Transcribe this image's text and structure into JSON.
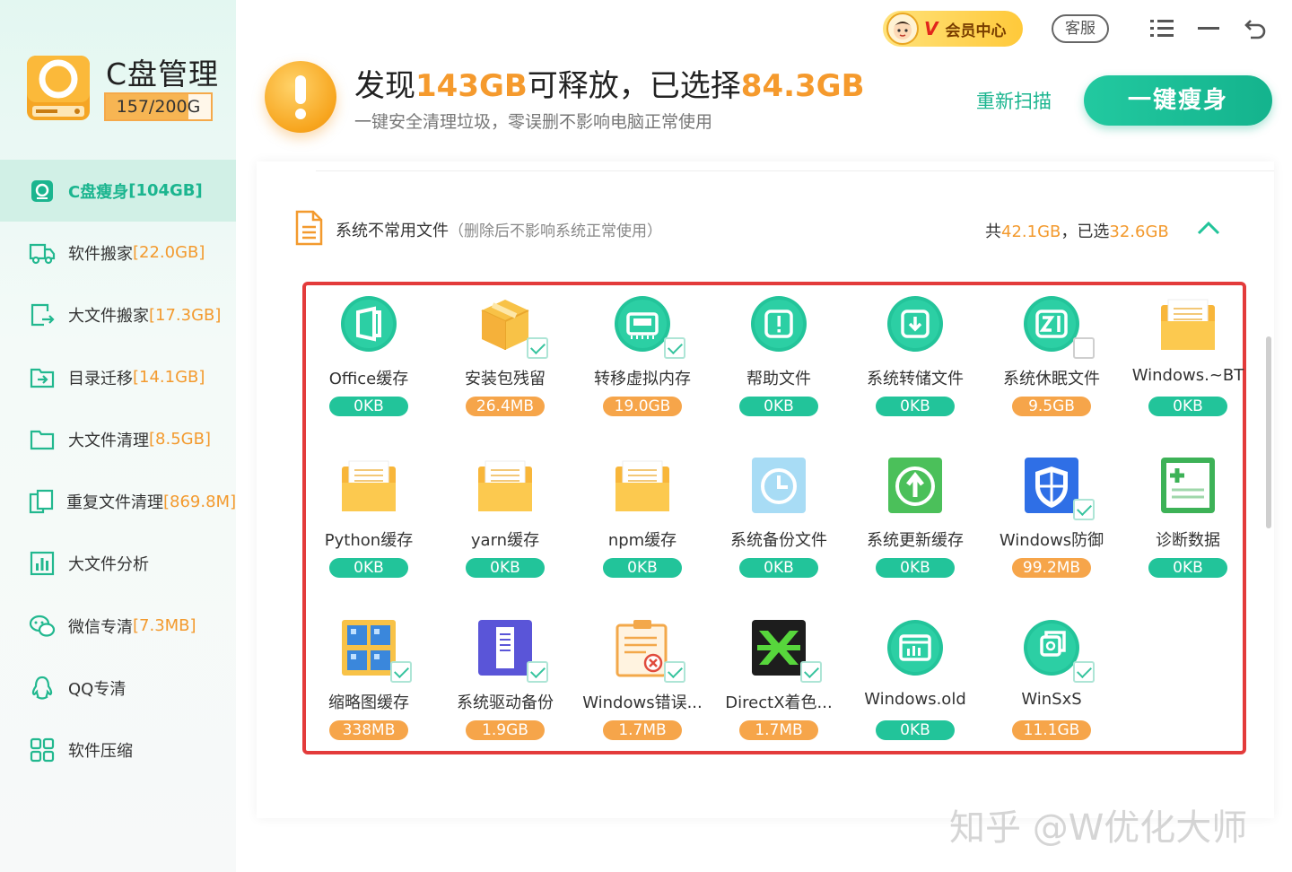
{
  "app": {
    "title": "C盘管理",
    "usage": "157/200G",
    "usage_fraction": 0.785
  },
  "sidebar": {
    "items": [
      {
        "label": "C盘瘦身",
        "size": "[104GB]",
        "icon": "broom-icon",
        "active": true
      },
      {
        "label": "软件搬家",
        "size": "[22.0GB]",
        "icon": "truck-icon"
      },
      {
        "label": "大文件搬家",
        "size": "[17.3GB]",
        "icon": "file-move-icon"
      },
      {
        "label": "目录迁移",
        "size": "[14.1GB]",
        "icon": "folder-migrate-icon"
      },
      {
        "label": "大文件清理",
        "size": "[8.5GB]",
        "icon": "folder-icon"
      },
      {
        "label": "重复文件清理",
        "size": "[869.8M]",
        "icon": "duplicate-icon"
      },
      {
        "label": "大文件分析",
        "size": "",
        "icon": "chart-icon"
      },
      {
        "label": "微信专清",
        "size": "[7.3MB]",
        "icon": "wechat-icon"
      },
      {
        "label": "QQ专清",
        "size": "",
        "icon": "qq-icon"
      },
      {
        "label": "软件压缩",
        "size": "",
        "icon": "compress-icon"
      }
    ]
  },
  "header": {
    "vip_label": "会员中心",
    "vip_badge": "V",
    "service_label": "客服",
    "headline_prefix": "发现",
    "headline_found": "143GB",
    "headline_mid": "可释放，已选择",
    "headline_selected": "84.3GB",
    "subline": "一键安全清理垃圾，零误删不影响电脑正常使用",
    "rescan_label": "重新扫描",
    "slim_button": "一键瘦身"
  },
  "section": {
    "title": "系统不常用文件",
    "note": "（删除后不影响系统正常使用）",
    "total_prefix": "共",
    "total": "42.1GB",
    "sep": "，已选",
    "selected": "32.6GB"
  },
  "tiles": [
    {
      "name": "Office缓存",
      "size": "0KB",
      "color": "green",
      "icon": "office-icon",
      "check": "none"
    },
    {
      "name": "安装包残留",
      "size": "26.4MB",
      "color": "orange",
      "icon": "package-box-icon",
      "check": "on"
    },
    {
      "name": "转移虚拟内存",
      "size": "19.0GB",
      "color": "orange",
      "icon": "memory-icon",
      "check": "on"
    },
    {
      "name": "帮助文件",
      "size": "0KB",
      "color": "green",
      "icon": "help-alert-icon",
      "check": "none"
    },
    {
      "name": "系统转储文件",
      "size": "0KB",
      "color": "green",
      "icon": "download-icon",
      "check": "none"
    },
    {
      "name": "系统休眠文件",
      "size": "9.5GB",
      "color": "orange",
      "icon": "sleep-z-icon",
      "check": "off"
    },
    {
      "name": "Windows.~BT",
      "size": "0KB",
      "color": "green",
      "icon": "yellow-folder-icon",
      "check": "none"
    },
    {
      "name": "Python缓存",
      "size": "0KB",
      "color": "green",
      "icon": "yellow-folder-icon",
      "check": "none"
    },
    {
      "name": "yarn缓存",
      "size": "0KB",
      "color": "green",
      "icon": "yellow-folder-icon",
      "check": "none"
    },
    {
      "name": "npm缓存",
      "size": "0KB",
      "color": "green",
      "icon": "yellow-folder-icon",
      "check": "none"
    },
    {
      "name": "系统备份文件",
      "size": "0KB",
      "color": "green",
      "icon": "backup-clock-icon",
      "check": "none"
    },
    {
      "name": "系统更新缓存",
      "size": "0KB",
      "color": "green",
      "icon": "update-arrow-icon",
      "check": "none"
    },
    {
      "name": "Windows防御",
      "size": "99.2MB",
      "color": "orange",
      "icon": "shield-icon",
      "check": "on"
    },
    {
      "name": "诊断数据",
      "size": "0KB",
      "color": "green",
      "icon": "diagnostic-plus-icon",
      "check": "none"
    },
    {
      "name": "缩略图缓存",
      "size": "338MB",
      "color": "orange",
      "icon": "thumbnail-grid-icon",
      "check": "on"
    },
    {
      "name": "系统驱动备份",
      "size": "1.9GB",
      "color": "orange",
      "icon": "driver-icon",
      "check": "on"
    },
    {
      "name": "Windows错误...",
      "size": "1.7MB",
      "color": "orange",
      "icon": "error-report-icon",
      "check": "on"
    },
    {
      "name": "DirectX着色...",
      "size": "1.7MB",
      "color": "orange",
      "icon": "directx-icon",
      "check": "on"
    },
    {
      "name": "Windows.old",
      "size": "0KB",
      "color": "green",
      "icon": "windows-old-icon",
      "check": "none"
    },
    {
      "name": "WinSxS",
      "size": "11.1GB",
      "color": "orange",
      "icon": "winsxs-icon",
      "check": "on"
    }
  ],
  "watermark": "知乎 @W优化大师"
}
